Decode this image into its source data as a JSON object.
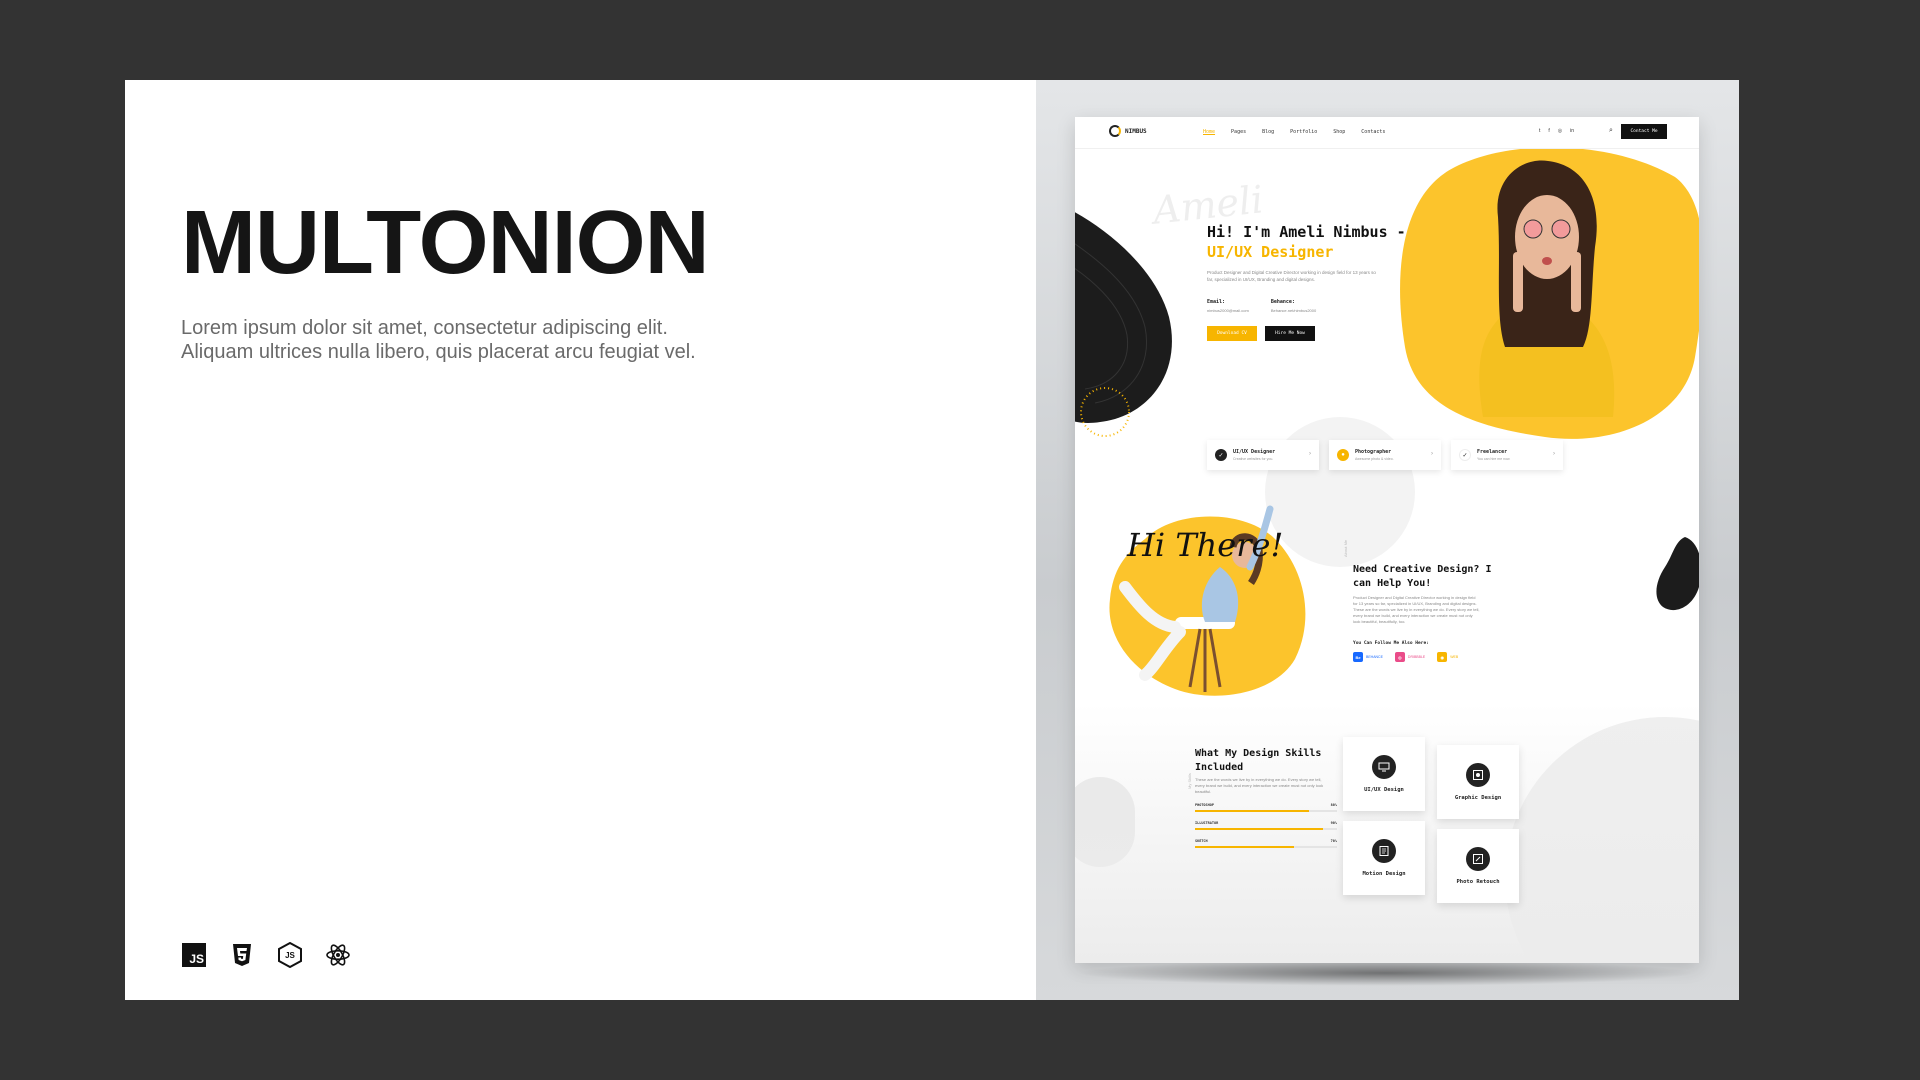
{
  "brand": {
    "title": "MULTONION",
    "description": "Lorem ipsum dolor sit amet, consectetur adipiscing elit. Aliquam ultrices nulla libero, quis placerat arcu feugiat vel.",
    "tech_icons": [
      "javascript-icon",
      "css3-icon",
      "nodejs-icon",
      "react-icon"
    ],
    "js_label": "JS"
  },
  "colors": {
    "accent": "#f7b500",
    "dark": "#111111",
    "background": "#333333"
  },
  "preview": {
    "nav": {
      "logo": "NIMBUS",
      "menu": [
        "Home",
        "Pages",
        "Blog",
        "Portfolio",
        "Shop",
        "Contacts"
      ],
      "social": [
        "twitter-icon",
        "facebook-icon",
        "instagram-icon",
        "linkedin-icon"
      ],
      "contact_button": "Contact Me"
    },
    "hero": {
      "script": "Ameli",
      "title": "Hi! I'm Ameli Nimbus -",
      "subtitle": "UI/UX Designer",
      "text": "Product Designer and Digital Creative Director working in design field for 13 years so far, specialized in UI/UX, Branding and digital designs.",
      "email_label": "Email:",
      "email_value": "nimbus2000@mail.com",
      "behance_label": "Behance:",
      "behance_value": "Behance.net/nimbus2000",
      "download_button": "Download CV",
      "hire_button": "Hire Me Now"
    },
    "services": [
      {
        "title": "UI/UX Designer",
        "desc": "Creative websites for you.",
        "color": "#222222",
        "icon": "check-icon"
      },
      {
        "title": "Photographer",
        "desc": "Awesome photo & video.",
        "color": "#f7b500",
        "icon": "camera-icon"
      },
      {
        "title": "Freelancer",
        "desc": "You can hire me now.",
        "color": "#ffffff",
        "icon": "check-icon"
      }
    ],
    "about": {
      "script": "Hi There!",
      "side_label": "About Me",
      "title": "Need Creative Design? I can Help You!",
      "text": "Product Designer and Digital Creative Director working in design field for 13 years so far, specialized in UI/UX, Branding and digital designs. These are the words we live by in everything we do. Every story we tell, every brand we build, and every interaction we create must not only look beautiful, beautifully, too.",
      "follow_label": "You Can Follow Me Also Here:",
      "follow": [
        {
          "name": "BEHANCE",
          "abbr": "Be",
          "color": "#1769ff"
        },
        {
          "name": "DRIBBBLE",
          "abbr": "◎",
          "color": "#ea4c89"
        },
        {
          "name": "WEB",
          "abbr": "◉",
          "color": "#f7b500"
        }
      ]
    },
    "skills": {
      "side_label": "My Skills",
      "title": "What My Design Skills Included",
      "text": "These are the words we live by in everything we do. Every story we tell, every brand we build, and every interaction we create must not only look beautiful.",
      "bars": [
        {
          "name": "PHOTOSHOP",
          "percent": 80,
          "label": "80%"
        },
        {
          "name": "ILLUSTRATOR",
          "percent": 90,
          "label": "90%"
        },
        {
          "name": "SKETCH",
          "percent": 70,
          "label": "70%"
        }
      ],
      "cards": [
        {
          "label": "UI/UX Design",
          "icon": "monitor-icon"
        },
        {
          "label": "Graphic Design",
          "icon": "palette-icon"
        },
        {
          "label": "Motion Design",
          "icon": "film-icon"
        },
        {
          "label": "Photo Retouch",
          "icon": "brush-icon"
        }
      ]
    }
  }
}
